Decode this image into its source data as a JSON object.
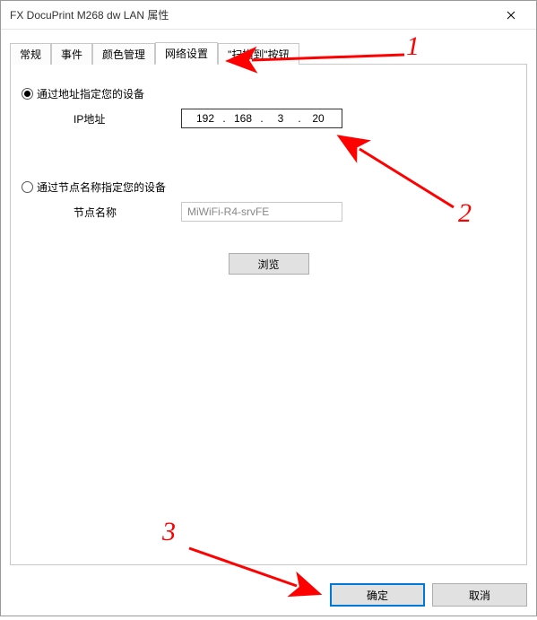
{
  "window": {
    "title": "FX DocuPrint M268 dw LAN 属性"
  },
  "tabs": {
    "general": "常规",
    "events": "事件",
    "color": "颜色管理",
    "network": "网络设置",
    "scanto": "\"扫描到\"按钮"
  },
  "net": {
    "radio_ip_label": "通过地址指定您的设备",
    "ip_label": "IP地址",
    "ip": {
      "a": "192",
      "b": "168",
      "c": "3",
      "d": "20"
    },
    "radio_node_label": "通过节点名称指定您的设备",
    "node_label": "节点名称",
    "node_value": "MiWiFi-R4-srvFE",
    "browse": "浏览"
  },
  "buttons": {
    "ok": "确定",
    "cancel": "取消"
  },
  "annotations": {
    "n1": "1",
    "n2": "2",
    "n3": "3"
  }
}
